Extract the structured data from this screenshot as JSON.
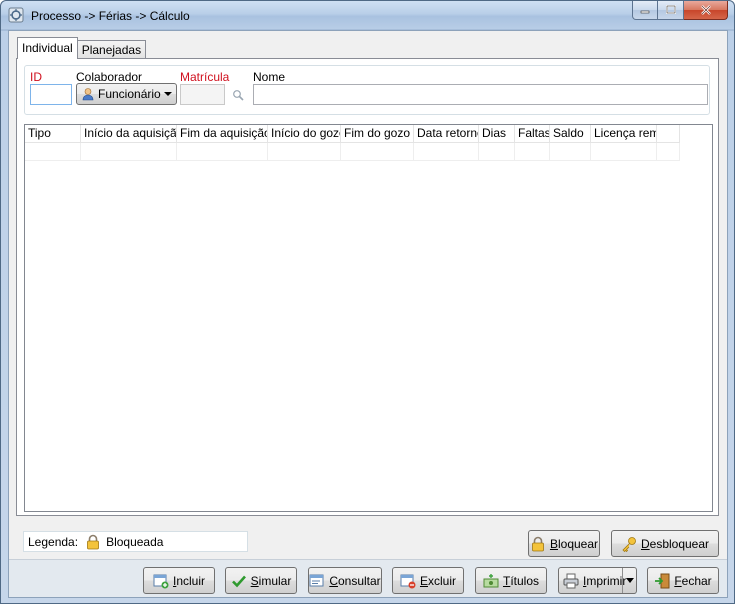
{
  "window": {
    "title": "Processo -> Férias -> Cálculo"
  },
  "tabs": [
    {
      "label": "Individual",
      "active": true
    },
    {
      "label": "Planejadas",
      "active": false
    }
  ],
  "filters": {
    "id_label": "ID",
    "colaborador_label": "Colaborador",
    "colaborador_value": "Funcionário",
    "matricula_label": "Matrícula",
    "nome_label": "Nome",
    "id_value": "",
    "matricula_value": "",
    "nome_value": ""
  },
  "grid": {
    "columns": [
      "Tipo",
      "Início da aquisição",
      "Fim da aquisição",
      "Início do gozo",
      "Fim do gozo",
      "Data retorno",
      "Dias",
      "Faltas",
      "Saldo",
      "Licença rem.",
      ""
    ],
    "rows": []
  },
  "legend": {
    "prefix": "Legenda:",
    "item": "Bloqueada",
    "icon": "lock-icon"
  },
  "lock_buttons": {
    "bloquear": {
      "label_u": "B",
      "label_rest": "loquear"
    },
    "desbloquear": {
      "label_u": "D",
      "label_rest": "esbloquear"
    }
  },
  "actions": {
    "incluir": {
      "label_u": "I",
      "label_rest": "ncluir"
    },
    "simular": {
      "label_u": "S",
      "label_rest": "imular"
    },
    "consultar": {
      "label_u": "C",
      "label_rest": "onsultar"
    },
    "excluir": {
      "label_u": "E",
      "label_rest": "xcluir"
    },
    "titulos": {
      "label_u": "T",
      "label_rest": "ítulos"
    },
    "imprimir": {
      "label_u": "I",
      "label_rest": "mprimir"
    },
    "fechar": {
      "label_u": "F",
      "label_rest": "echar"
    }
  },
  "colors": {
    "required_label": "#d0101e",
    "accent_blue": "#7eb4ea"
  }
}
